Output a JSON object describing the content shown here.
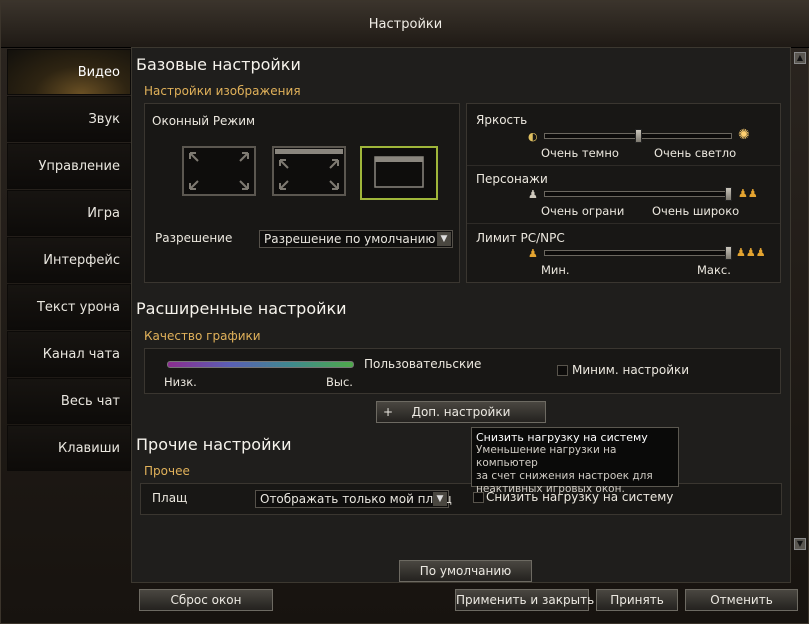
{
  "window": {
    "title": "Настройки"
  },
  "nav": [
    {
      "label": "Видео",
      "active": true
    },
    {
      "label": "Звук"
    },
    {
      "label": "Управление"
    },
    {
      "label": "Игра"
    },
    {
      "label": "Интерфейс"
    },
    {
      "label": "Текст урона"
    },
    {
      "label": "Канал чата"
    },
    {
      "label": "Весь чат"
    },
    {
      "label": "Клавиши"
    }
  ],
  "basic": {
    "title": "Базовые настройки",
    "image_header": "Настройки изображения",
    "window_mode_label": "Оконный Режим",
    "resolution_label": "Разрешение",
    "resolution_value": "Разрешение по умолчанию",
    "brightness": {
      "label": "Яркость",
      "min": "Очень темно",
      "max": "Очень светло",
      "level": 0.5
    },
    "characters": {
      "label": "Персонажи",
      "min": "Очень ограни",
      "max": "Очень широко",
      "level": 1.0
    },
    "pc_limit": {
      "label": "Лимит PC/NPC",
      "min": "Мин.",
      "max": "Макс.",
      "level": 1.0
    }
  },
  "advanced": {
    "title": "Расширенные настройки",
    "quality_header": "Качество графики",
    "preset": "Пользовательские",
    "low": "Низк.",
    "high": "Выс.",
    "min_settings": "Миним. настройки",
    "more_button": "Доп. настройки",
    "plus": "+"
  },
  "other": {
    "title": "Прочие настройки",
    "header": "Прочее",
    "cloak_label": "Плащ",
    "cloak_value": "Отображать только мой плащ",
    "reduce_load": "Снизить нагрузку на систему"
  },
  "tooltip": {
    "title": "Снизить нагрузку на систему",
    "line1": "Уменьшение нагрузки на компьютер",
    "line2": "за счет снижения настроек для",
    "line3": "неактивных игровых окон."
  },
  "buttons": {
    "default": "По умолчанию",
    "reset_windows": "Сброс окон",
    "apply_close": "Применить и закрыть",
    "accept": "Принять",
    "cancel": "Отменить"
  },
  "colors": {
    "accent": "#e0b15a",
    "selected_mode": "#9fb63a"
  }
}
